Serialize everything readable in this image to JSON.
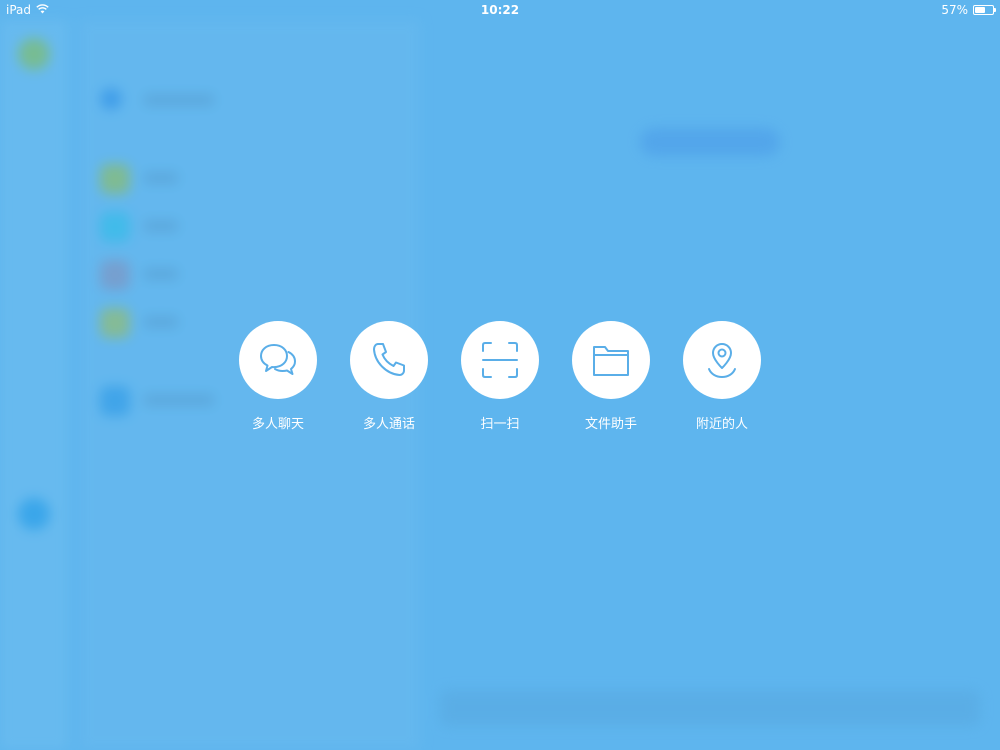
{
  "status_bar": {
    "device": "iPad",
    "time": "10:22",
    "battery_percent": "57%",
    "battery_level": 0.57,
    "icons": [
      "wifi-icon",
      "battery-icon"
    ]
  },
  "colors": {
    "overlay_background": "#5eb5ee",
    "action_circle": "#ffffff",
    "icon_stroke": "#5aaee8",
    "label_text": "#ffffff"
  },
  "actions": [
    {
      "label": "多人聊天",
      "icon": "chat-bubbles-icon"
    },
    {
      "label": "多人通话",
      "icon": "phone-icon"
    },
    {
      "label": "扫一扫",
      "icon": "scan-icon"
    },
    {
      "label": "文件助手",
      "icon": "folder-icon"
    },
    {
      "label": "附近的人",
      "icon": "location-pin-icon"
    }
  ]
}
